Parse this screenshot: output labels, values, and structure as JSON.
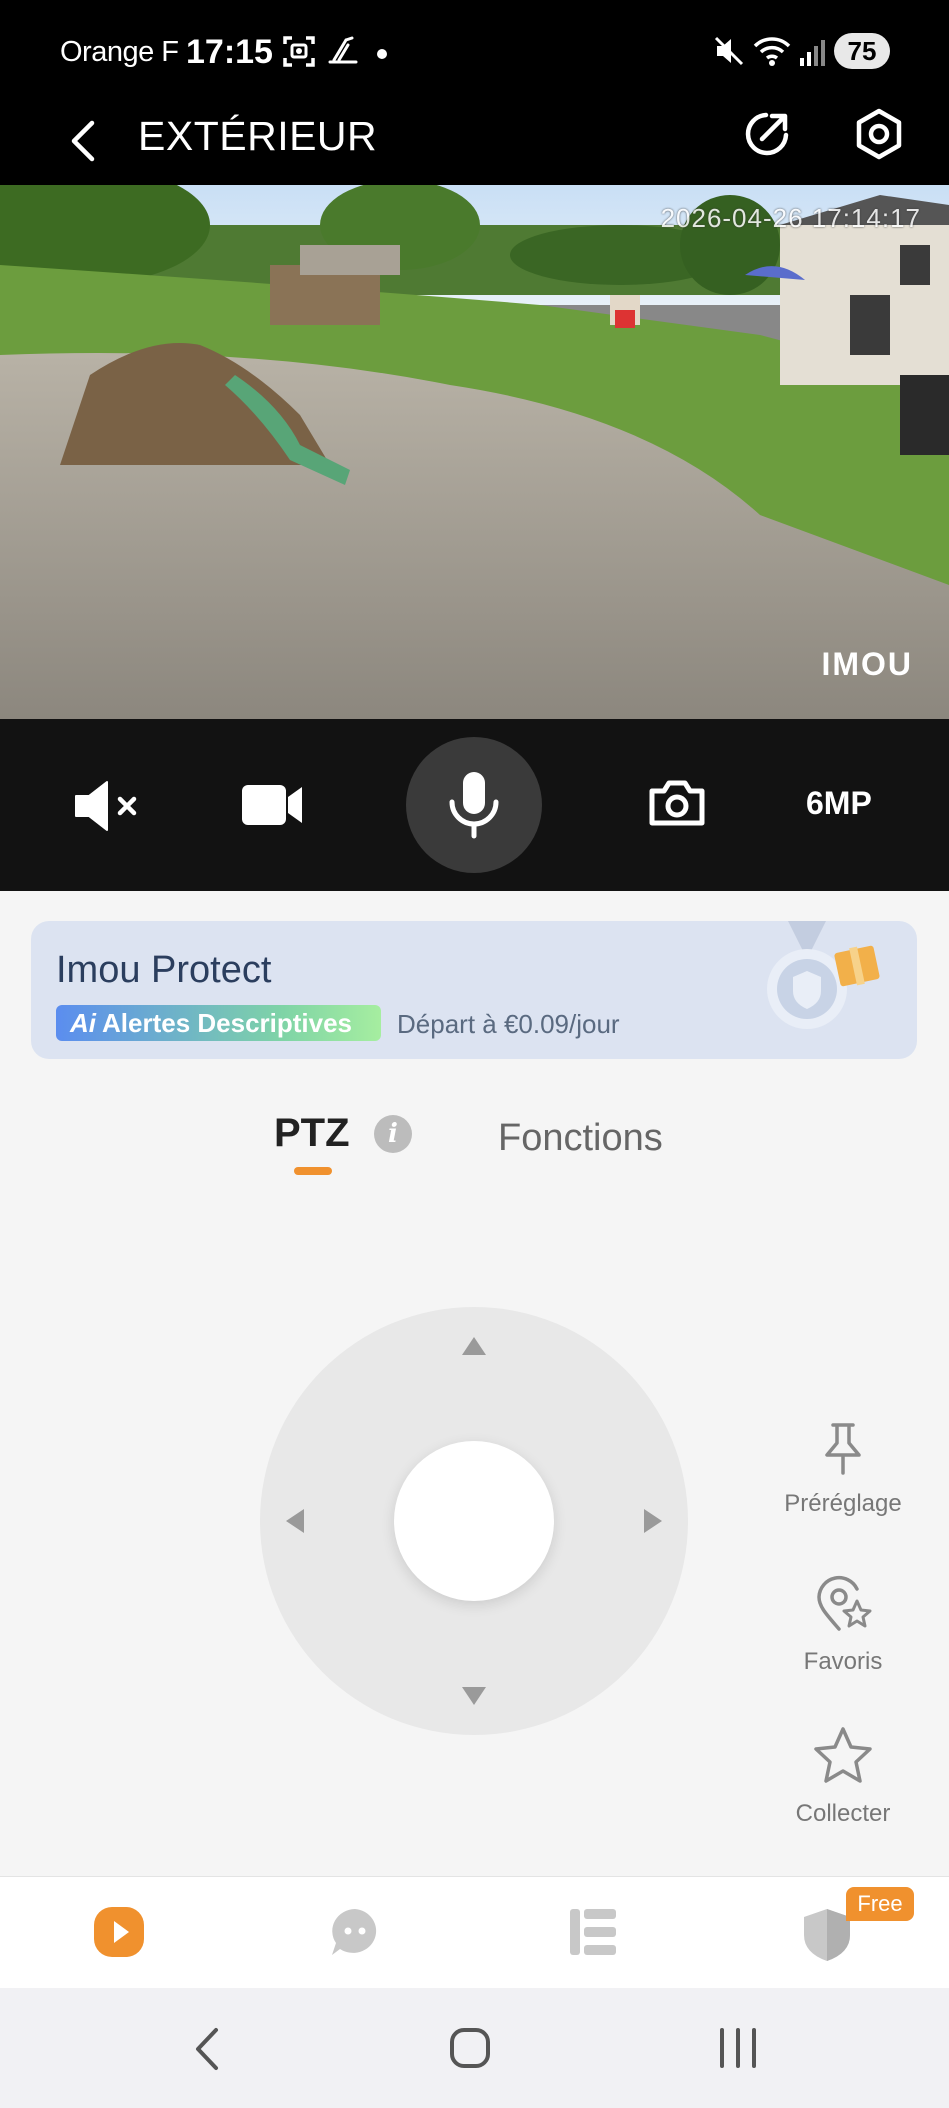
{
  "status_bar": {
    "carrier": "Orange F",
    "time": "17:15",
    "battery": "75"
  },
  "header": {
    "title": "EXTÉRIEUR"
  },
  "video": {
    "timestamp": "2026-04-26 17:14:17",
    "brand": "IMOU"
  },
  "controls": {
    "resolution": "6MP"
  },
  "promo": {
    "title": "Imou Protect",
    "chip": "Alertes Descriptives",
    "price": "Départ à €0.09/jour"
  },
  "tabs": {
    "ptz": "PTZ",
    "functions": "Fonctions",
    "info": "i"
  },
  "side_actions": [
    {
      "label": "Préréglage",
      "icon": "pin-icon"
    },
    {
      "label": "Favoris",
      "icon": "location-star-icon"
    },
    {
      "label": "Collecter",
      "icon": "star-icon"
    }
  ],
  "tabbar": {
    "free_badge": "Free",
    "accent": "#f0912e"
  },
  "colors": {
    "accent": "#f0912e",
    "promo_bg": "#dce3f1"
  }
}
